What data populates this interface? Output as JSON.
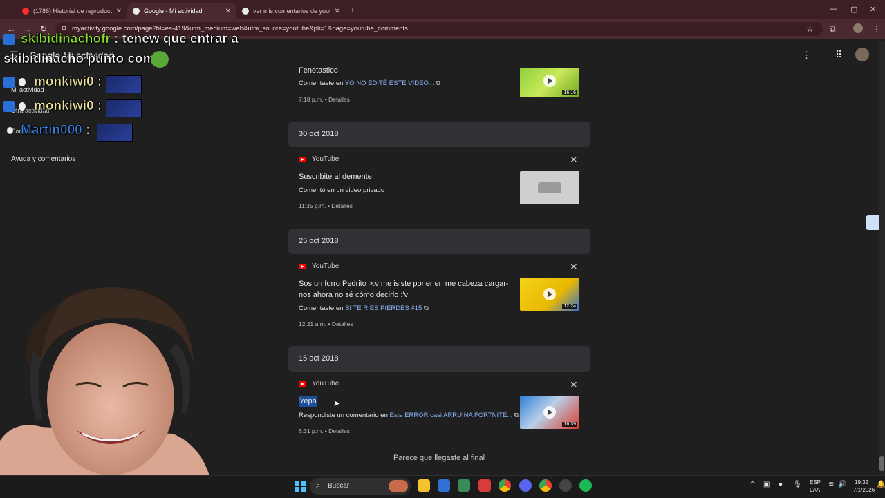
{
  "browser": {
    "tabs": [
      {
        "title": "(1786) Historial de reproducción",
        "active": false
      },
      {
        "title": "Google - Mi actividad",
        "active": true
      },
      {
        "title": "ver mis comentarios de youtube",
        "active": false
      }
    ],
    "new_tab": "+",
    "window_controls": [
      "—",
      "▢",
      "✕"
    ],
    "url": "myactivity.google.com/page?hl=es-419&utm_medium=web&utm_source=youtube&pli=1&page=youtube_comments"
  },
  "app": {
    "title": "Google Mi actividad"
  },
  "sidebar": {
    "items": [
      "Mi actividad",
      "Otra actividad",
      "Controles"
    ],
    "help": "Ayuda y comentarios"
  },
  "activity": {
    "top_partial": {
      "title": "Fenetastico",
      "meta_prefix": "Comentaste en",
      "link": "YO NO EDITÉ ESTE VIDEO...",
      "time": "7:18 p.m. • Detalles",
      "duration": "16:16"
    },
    "groups": [
      {
        "date": "30 oct 2018",
        "source": "YouTube",
        "title": "Suscribite al demente",
        "meta_prefix": "Comentó en un video privado",
        "link": "",
        "time": "11:35 p.m. • Detalles",
        "duration": ""
      },
      {
        "date": "25 oct 2018",
        "source": "YouTube",
        "title": "Sos un forro Pedrito >:v me isiste poner en me cabeza cargar-nos ahora no sé cómo decirlo :'v",
        "meta_prefix": "Comentaste en",
        "link": "SI TE RÍES PIERDES #15",
        "time": "12:21 a.m. • Detalles",
        "duration": "12:24"
      },
      {
        "date": "15 oct 2018",
        "source": "YouTube",
        "title": "Yepa",
        "meta_prefix": "Respondiste un comentario en",
        "link": "Este ERROR casi ARRUINA FORTNITE...",
        "time": "6:31 p.m. • Detalles",
        "duration": "16:39"
      }
    ],
    "end_text": "Parece que llegaste al final"
  },
  "stream_chat": {
    "lines": [
      {
        "name": "skibidinachofr",
        "text": ": tenew que entrar a"
      },
      {
        "name": "",
        "text": "skibidinacho punto com"
      },
      {
        "name": "monkiwi0",
        "text": ":"
      },
      {
        "name": "monkiwi0",
        "text": ":"
      },
      {
        "name": "Martin000",
        "text": ":"
      }
    ]
  },
  "taskbar": {
    "search_label": "Buscar",
    "lang": "ESP",
    "layout": "LAA",
    "time": "19:32",
    "date": "7/1/2026"
  }
}
